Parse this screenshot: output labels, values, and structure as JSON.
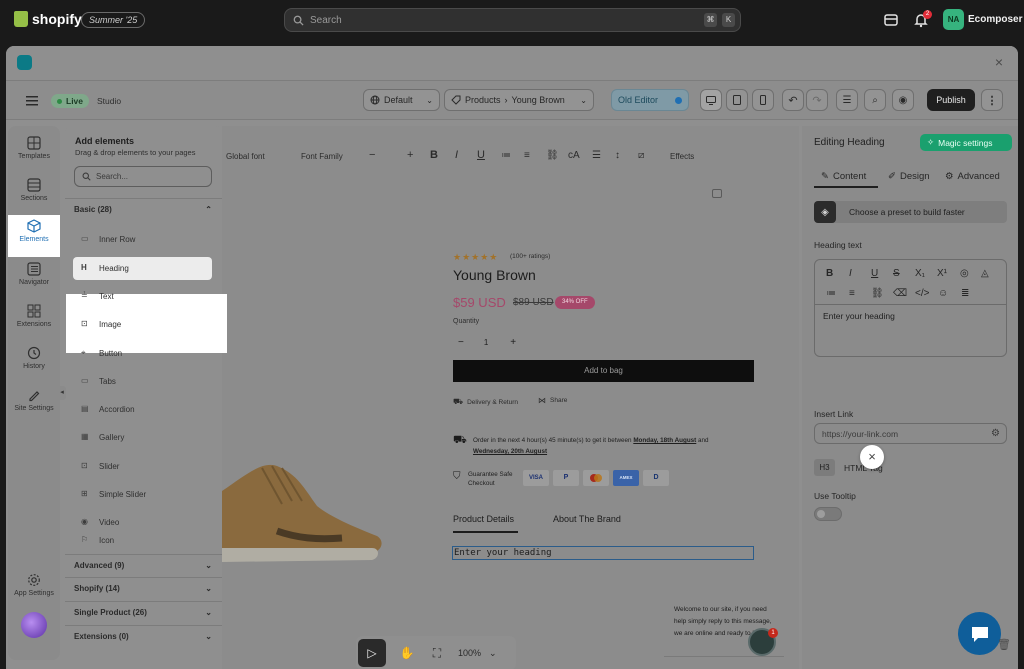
{
  "topbar": {
    "logo_text": "shopify",
    "badge": "Summer '25",
    "search_placeholder": "Search",
    "kbd1": "⌘",
    "kbd2": "K",
    "notif_count": "2",
    "avatar_initials": "NA",
    "store_name": "Ecomposer"
  },
  "toolbar": {
    "live_label": "Live",
    "studio_label": "Studio",
    "template_select": "Default",
    "breadcrumb_root": "Products",
    "breadcrumb_item": "Young Brown",
    "old_editor_label": "Old Editor",
    "publish_label": "Publish"
  },
  "rail": {
    "items": [
      {
        "label": "Templates",
        "icon": "templates-icon"
      },
      {
        "label": "Sections",
        "icon": "sections-icon"
      },
      {
        "label": "Elements",
        "icon": "elements-icon"
      },
      {
        "label": "Navigator",
        "icon": "navigator-icon"
      },
      {
        "label": "Extensions",
        "icon": "extensions-icon"
      },
      {
        "label": "History",
        "icon": "history-icon"
      },
      {
        "label": "Site Settings",
        "icon": "site-settings-icon"
      }
    ],
    "app_settings": "App Settings"
  },
  "add_panel": {
    "title": "Add elements",
    "subtitle": "Drag & drop elements to your pages",
    "search_placeholder": "Search...",
    "basic_label": "Basic (28)",
    "items": [
      "Inner Row",
      "Heading",
      "Text",
      "Image",
      "Button",
      "Tabs",
      "Accordion",
      "Gallery",
      "Slider",
      "Simple Slider",
      "Video",
      "Icon"
    ],
    "sections": [
      "Advanced (9)",
      "Shopify (14)",
      "Single Product (26)",
      "Extensions (0)"
    ]
  },
  "rich_toolbar": {
    "global_font": "Global font",
    "font_family": "Font Family",
    "effects": "Effects"
  },
  "product": {
    "rating": "(100+ ratings)",
    "title": "Young Brown",
    "price": "$59 USD",
    "compare_price": "$89 USD",
    "discount": "34% OFF",
    "quantity_label": "Quantity",
    "qty_value": "1",
    "add_to_bag": "Add to bag",
    "delivery": "Delivery & Return",
    "share": "Share",
    "shipping_msg_1": "Order in the next 4 hour(s) 45 minute(s) to get it between",
    "date1": "Monday, 18th August",
    "and": "and",
    "date2": "Wednesday, 20th August",
    "guarantee": "Guarantee Safe Checkout",
    "payments": [
      "VISA",
      "P",
      "MC",
      "AMEX",
      "D"
    ],
    "tab1": "Product Details",
    "tab2": "About The Brand",
    "heading_placeholder": "Enter your heading",
    "chat_msg": "Welcome to our site, if you need help simply reply to this message, we are online and ready to help."
  },
  "right_panel": {
    "title": "Editing Heading",
    "magic_label": "Magic settings",
    "tabs": [
      "Content",
      "Design",
      "Advanced"
    ],
    "preset_label": "Choose a preset to build faster",
    "heading_text_label": "Heading text",
    "heading_placeholder": "Enter your heading",
    "insert_link_label": "Insert Link",
    "link_placeholder": "https://your-link.com",
    "html_tag_badge": "H3",
    "html_tag_label": "HTML Tag",
    "use_tooltip_label": "Use Tooltip"
  },
  "canvas_tools": {
    "zoom": "100%"
  },
  "help_badge": "1",
  "colors": {
    "shopify_green": "#95bf47",
    "live_green": "#3fbf5e",
    "publish_bg": "#1f1f1f",
    "magic_green": "#1aa06e",
    "price_pink": "#c44d7a",
    "elements_active": "#1f6fb3"
  }
}
